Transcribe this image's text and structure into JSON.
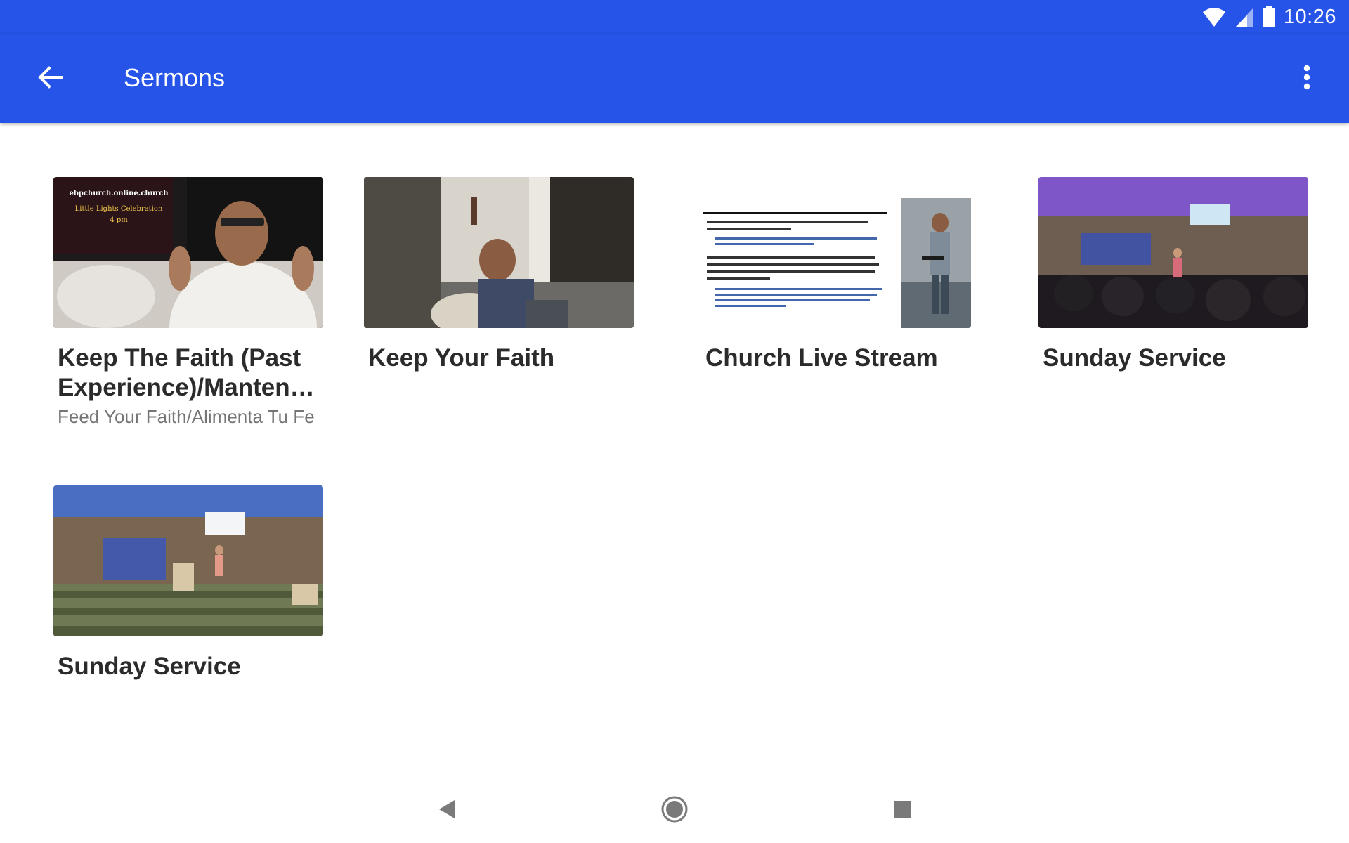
{
  "status_bar": {
    "time": "10:26",
    "icons": [
      "wifi-icon",
      "signal-icon",
      "battery-icon"
    ]
  },
  "app_bar": {
    "title": "Sermons",
    "back_icon": "arrow-left-icon",
    "menu_icon": "more-vert-icon"
  },
  "sermons": [
    {
      "title": "Keep The Faith (Past Experience)/Manten la Fe (Experiencias Pasadas)",
      "subtitle": "Feed Your Faith/Alimenta Tu Fe",
      "thumb_text": [
        "ebpchurch.online.church",
        "Little Lights Celebration",
        "4 pm"
      ]
    },
    {
      "title": "Keep Your Faith",
      "subtitle": ""
    },
    {
      "title": "Church Live Stream",
      "subtitle": ""
    },
    {
      "title": "Sunday Service",
      "subtitle": ""
    },
    {
      "title": "Sunday Service",
      "subtitle": ""
    }
  ],
  "colors": {
    "primary": "#2653e8",
    "title_text": "#2b2b2b",
    "subtitle_text": "#757575",
    "nav_icons": "#7a7a7a"
  },
  "nav_bar": {
    "icons": [
      "back-triangle-icon",
      "home-circle-icon",
      "recents-square-icon"
    ]
  }
}
